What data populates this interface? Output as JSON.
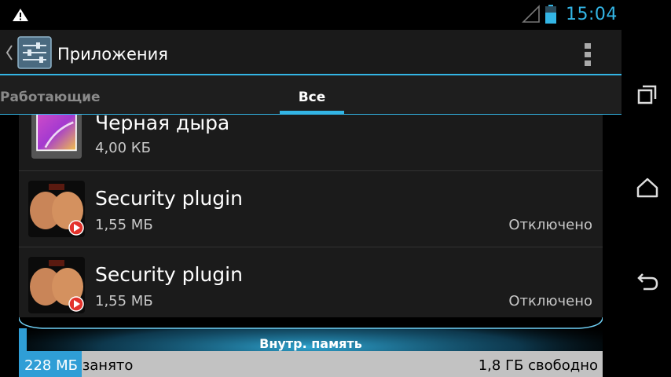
{
  "status_bar": {
    "time": "15:04",
    "icons": [
      "warning-icon",
      "signal-icon",
      "battery-icon"
    ],
    "accent_color": "#33b5e5"
  },
  "action_bar": {
    "title": "Приложения",
    "icons": [
      "chevron-left-icon",
      "settings-app-icon",
      "overflow-menu-icon"
    ]
  },
  "tabs": [
    {
      "label": "Работающие",
      "selected": false
    },
    {
      "label": "Все",
      "selected": true
    }
  ],
  "apps": [
    {
      "name": "Черная дыра",
      "size": "4,00 КБ",
      "status": "",
      "icon": "gallery-app-icon"
    },
    {
      "name": "Security plugin",
      "size": "1,55 МБ",
      "status": "Отключено",
      "icon": "security-plugin-icon"
    },
    {
      "name": "Security plugin",
      "size": "1,55 МБ",
      "status": "Отключено",
      "icon": "security-plugin-icon"
    }
  ],
  "storage": {
    "label": "Внутр. память",
    "used_value": "228 МБ",
    "used_suffix": "занято",
    "free_text": "1,8 ГБ свободно",
    "used_fraction": 0.107,
    "used_color": "#2f9ed6",
    "free_color": "#c2c2c2"
  },
  "nav_bar": {
    "icons": [
      "recent-apps-icon",
      "home-icon",
      "back-icon"
    ]
  }
}
